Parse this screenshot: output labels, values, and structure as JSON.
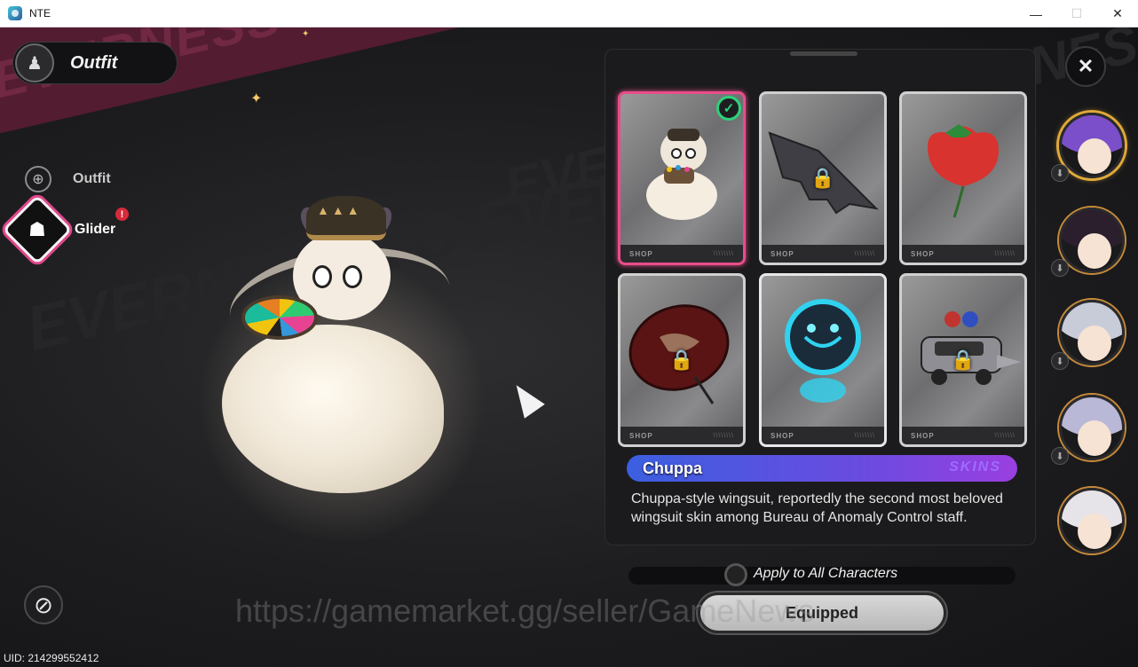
{
  "window": {
    "title": "NTE",
    "minimize": "—",
    "maximize": "☐",
    "close": "✕"
  },
  "header": {
    "title": "Outfit"
  },
  "nav": {
    "items": [
      {
        "label": "Outfit",
        "icon": "crosshair-icon",
        "active": false
      },
      {
        "label": "Glider",
        "icon": "ghost-icon",
        "active": true,
        "alert": "!"
      }
    ]
  },
  "background_text": "EVERNESS TO EVERNESS",
  "cards": [
    {
      "art": "chuppa-glider",
      "shop_label": "SHOP",
      "locked": false,
      "selected": true,
      "equipped_mark": "✓"
    },
    {
      "art": "bat-wing-glider",
      "shop_label": "SHOP",
      "locked": true,
      "selected": false
    },
    {
      "art": "strawberry-glider",
      "shop_label": "SHOP",
      "locked": false,
      "selected": false
    },
    {
      "art": "umbrella-glider",
      "shop_label": "SHOP",
      "locked": true,
      "selected": false
    },
    {
      "art": "spirit-flame-glider",
      "shop_label": "SHOP",
      "locked": false,
      "selected": false
    },
    {
      "art": "police-car-glider",
      "shop_label": "SHOP",
      "locked": true,
      "selected": false
    }
  ],
  "selected_item": {
    "name": "Chuppa",
    "type": "SKINS",
    "description": "Chuppa-style wingsuit, reportedly the second most beloved wingsuit skin among Bureau of Anomaly Control staff."
  },
  "apply_all_label": "Apply to All Characters",
  "equip_button": "Equipped",
  "uid": "UID: 214299552412",
  "watermark": "https://gamemarket.gg/seller/GameNews",
  "characters": [
    {
      "name": "character-1",
      "active": true,
      "hair": "#7b4fc9"
    },
    {
      "name": "character-2",
      "active": false,
      "hair": "#2b1f2e"
    },
    {
      "name": "character-3",
      "active": false,
      "hair": "#c8ccd8"
    },
    {
      "name": "character-4",
      "active": false,
      "hair": "#b9b8d6"
    },
    {
      "name": "character-5",
      "active": false,
      "hair": "#e7e4e9"
    }
  ],
  "colors": {
    "accent_pink": "#e84d8a",
    "equipped_green": "#2dd27a",
    "name_bar_start": "#3b5fe0",
    "name_bar_end": "#9a3fe0",
    "active_ring": "#e0a93a"
  }
}
